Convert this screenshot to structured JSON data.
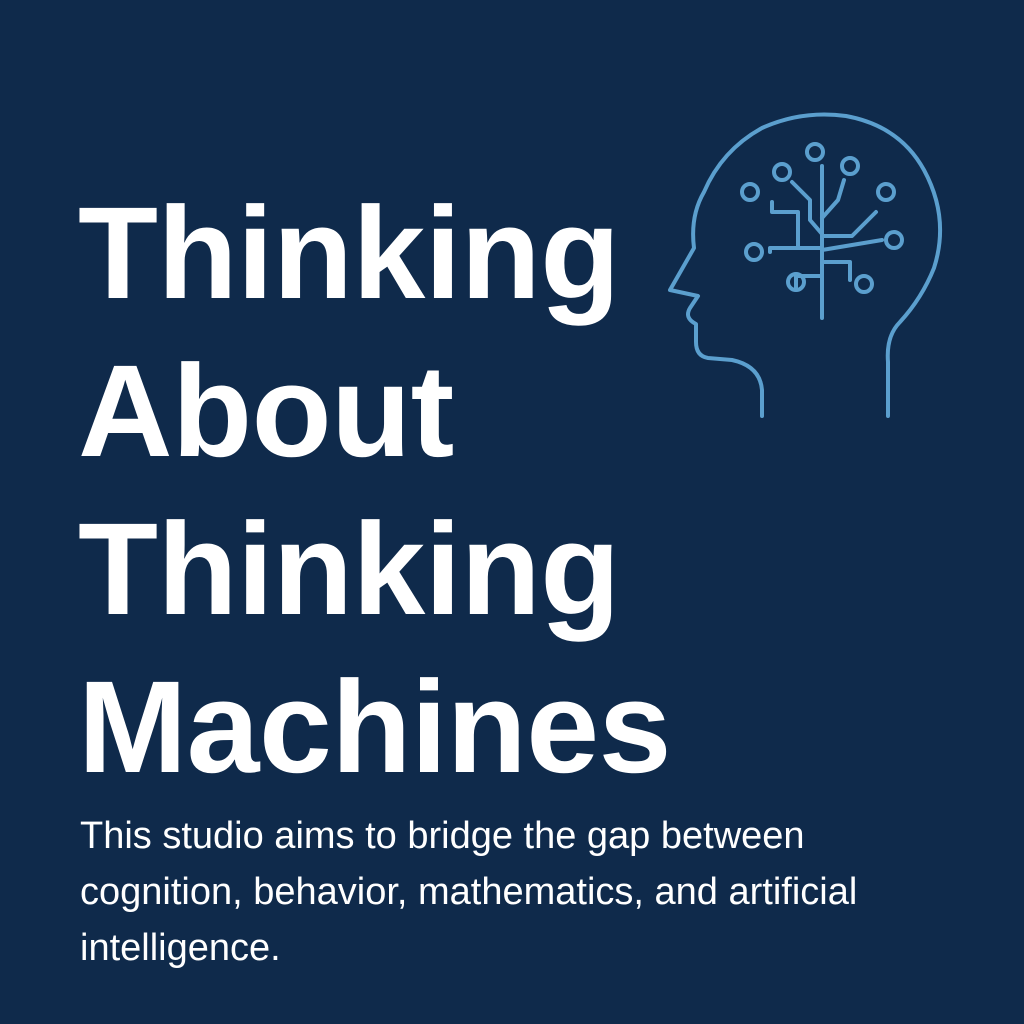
{
  "poster": {
    "title_lines": [
      "Thinking",
      "About",
      "Thinking",
      "Machines"
    ],
    "description": "This studio aims to bridge the gap between cognition, behavior, mathematics, and artificial intelligence."
  },
  "icon": {
    "name": "brain-circuit-head-icon"
  },
  "colors": {
    "background": "#0f2a4b",
    "text": "#ffffff",
    "accent": "#5b9fce"
  }
}
